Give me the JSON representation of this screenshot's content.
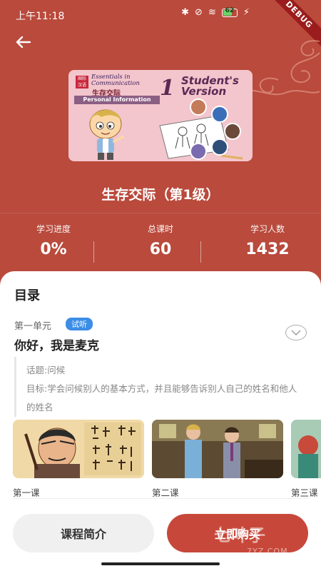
{
  "status": {
    "time": "上午11:18",
    "battery": "62",
    "battery_level": 0.62,
    "debug": "DEBUG"
  },
  "cover": {
    "logo": "国际 汉语",
    "title_line1": "Essentials in",
    "title_line2": "Communication",
    "subtitle": "生存交际",
    "ribbon": "Personal Information",
    "number": "1",
    "version_line1": "Student's",
    "version_line2": "Version"
  },
  "course": {
    "title": "生存交际（第1级）"
  },
  "stats": [
    {
      "label": "学习进度",
      "value": "0%"
    },
    {
      "label": "总课时",
      "value": "60"
    },
    {
      "label": "学习人数",
      "value": "1432"
    }
  ],
  "toc": {
    "title": "目录",
    "unit": {
      "label": "第一单元",
      "badge": "试听",
      "title": "你好，我是麦克",
      "topic": "话题:问候",
      "goal": "目标:学会问候别人的基本方式，并且能够告诉别人自己的姓名和他人的姓名"
    },
    "lessons": [
      {
        "label": "第一课"
      },
      {
        "label": "第二课"
      },
      {
        "label": "第三课"
      }
    ]
  },
  "actions": {
    "intro_label": "课程简介",
    "buy_label": "立即购买"
  },
  "watermark": {
    "text": "七叶子",
    "sub": "7YZ.COM"
  },
  "colors": {
    "brand": "#b94a3c",
    "button": "#c7483a",
    "badge": "#3b8de6"
  }
}
